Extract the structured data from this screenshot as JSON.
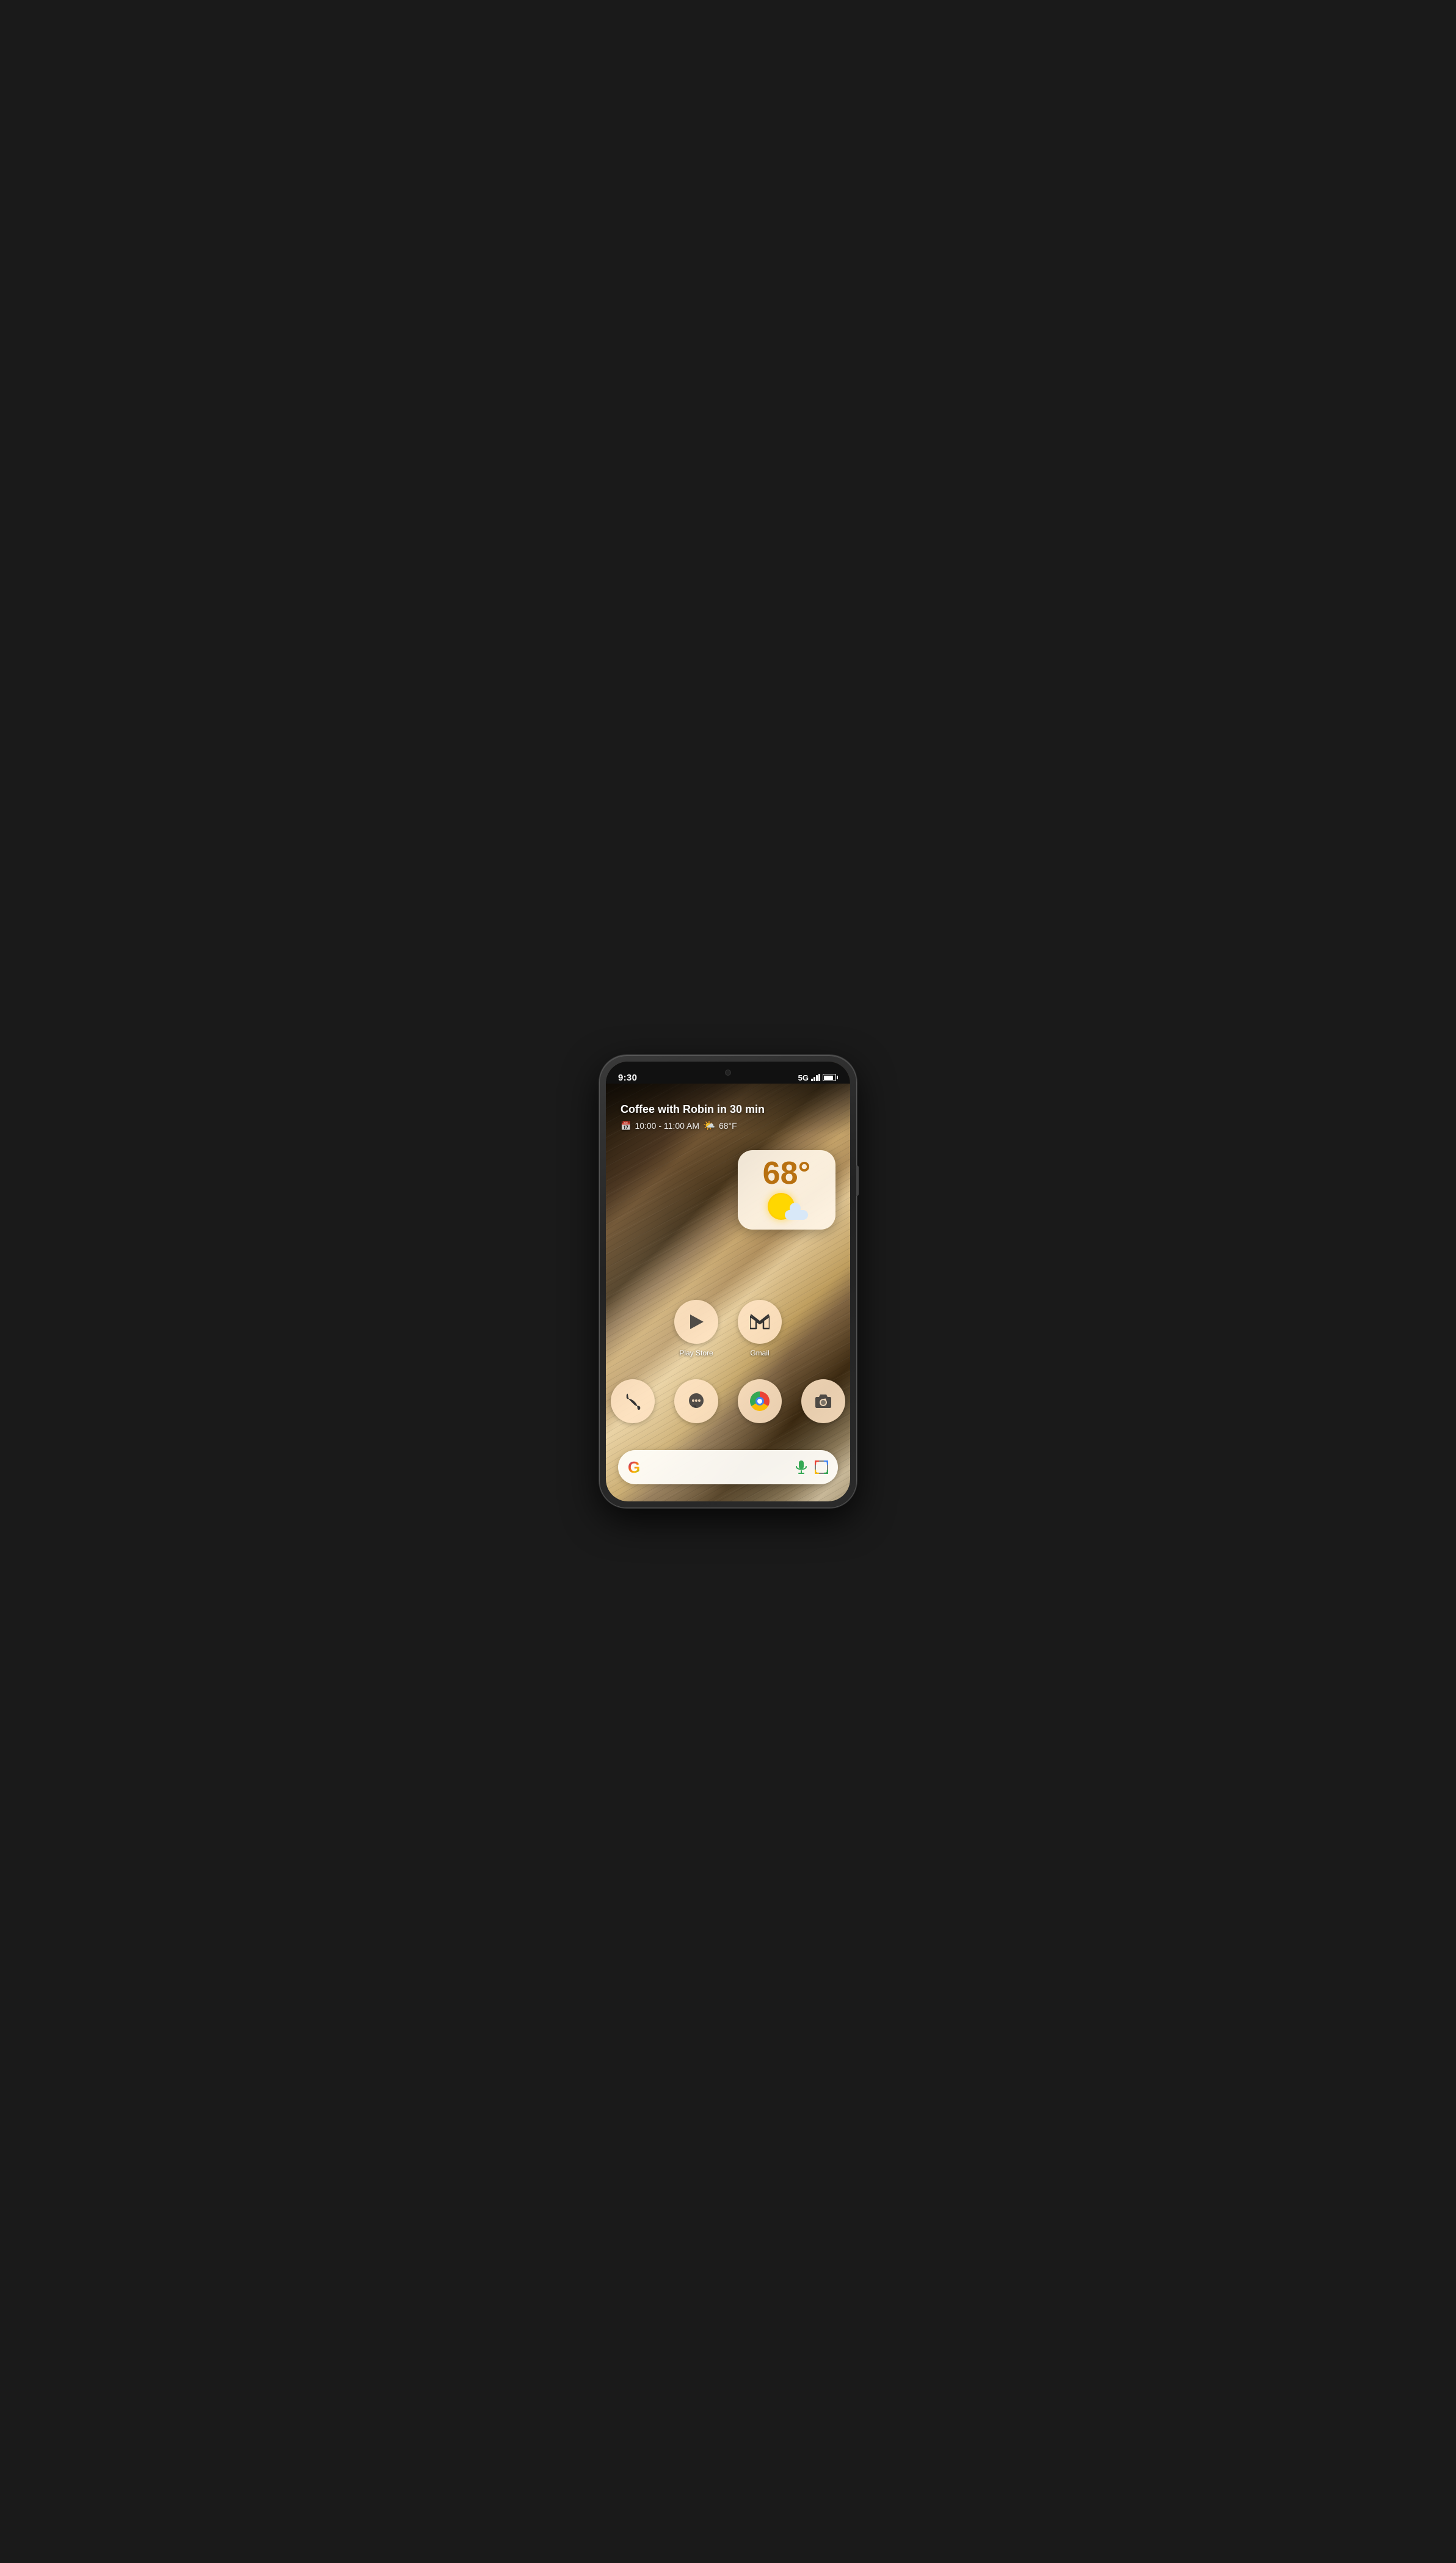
{
  "phone": {
    "status_bar": {
      "time": "9:30",
      "network": "5G",
      "signal_bars": 4,
      "battery_percent": 85
    },
    "notification": {
      "title": "Coffee with Robin in 30 min",
      "time_range": "10:00 - 11:00 AM",
      "weather_inline": "68°F",
      "weather_icon": "partly-cloudy"
    },
    "weather_widget": {
      "temperature": "68°",
      "condition": "partly-cloudy"
    },
    "app_row_1": [
      {
        "id": "play-store",
        "label": "Play Store",
        "icon": "play-triangle"
      },
      {
        "id": "gmail",
        "label": "Gmail",
        "icon": "m-letter"
      }
    ],
    "app_row_2": [
      {
        "id": "phone",
        "label": "",
        "icon": "phone"
      },
      {
        "id": "messages",
        "label": "",
        "icon": "chat-bubble"
      },
      {
        "id": "chrome",
        "label": "",
        "icon": "chrome"
      },
      {
        "id": "camera",
        "label": "",
        "icon": "camera"
      }
    ],
    "search_bar": {
      "google_label": "G",
      "mic_label": "mic",
      "lens_label": "lens"
    }
  }
}
